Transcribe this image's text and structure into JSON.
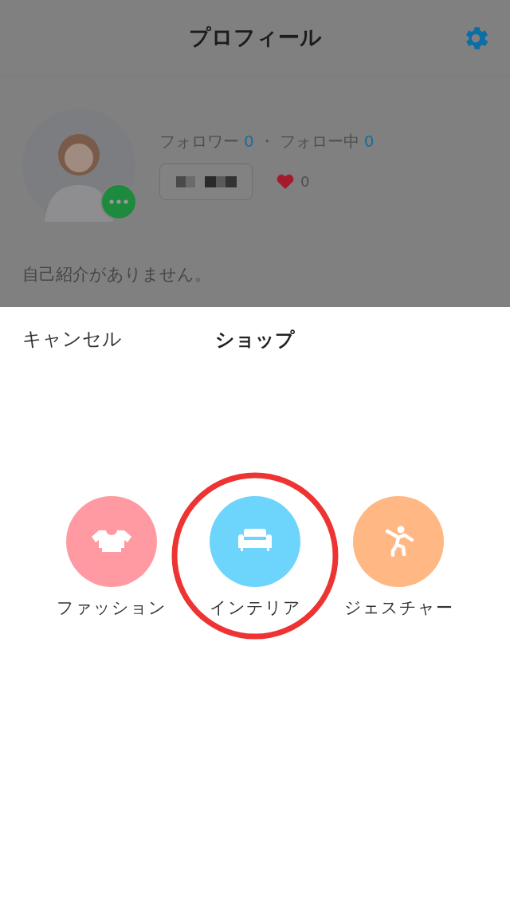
{
  "header": {
    "title": "プロフィール"
  },
  "profile": {
    "followers_label": "フォロワー",
    "followers": "0",
    "separator": "・",
    "following_label": "フォロー中",
    "following": "0",
    "likes": "0",
    "bio": "自己紹介がありません。"
  },
  "sheet": {
    "cancel": "キャンセル",
    "title": "ショップ",
    "items": [
      {
        "label": "ファッション",
        "kind": "shirt",
        "color": "#ff9aa2",
        "circled": false
      },
      {
        "label": "インテリア",
        "kind": "sofa",
        "color": "#6dd5fb",
        "circled": true
      },
      {
        "label": "ジェスチャー",
        "kind": "dance",
        "color": "#ffb783",
        "circled": false
      }
    ]
  }
}
